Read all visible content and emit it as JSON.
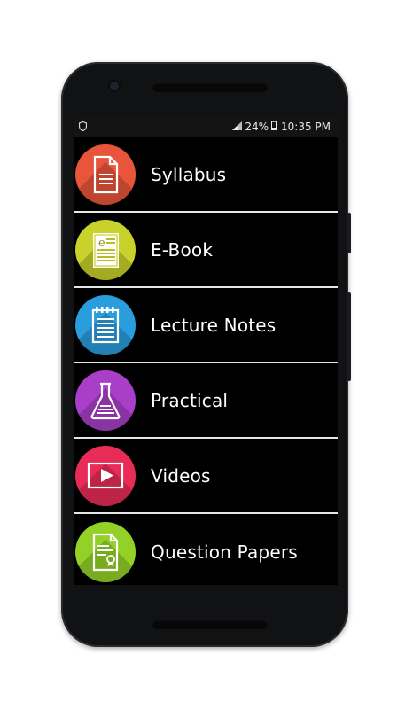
{
  "status_bar": {
    "battery": "24%",
    "time": "10:35 PM",
    "icons": [
      "shield-icon",
      "signal-icon",
      "battery-icon"
    ]
  },
  "menu": {
    "items": [
      {
        "label": "Syllabus",
        "icon": "document-icon",
        "color": "#E8553B"
      },
      {
        "label": "E-Book",
        "icon": "ebook-icon",
        "color": "#C9D12B"
      },
      {
        "label": "Lecture Notes",
        "icon": "notepad-icon",
        "color": "#2A9DDC"
      },
      {
        "label": "Practical",
        "icon": "flask-icon",
        "color": "#A93FC8"
      },
      {
        "label": "Videos",
        "icon": "play-video-icon",
        "color": "#E82C57"
      },
      {
        "label": "Question Papers",
        "icon": "certificate-document-icon",
        "color": "#93D128"
      }
    ]
  }
}
